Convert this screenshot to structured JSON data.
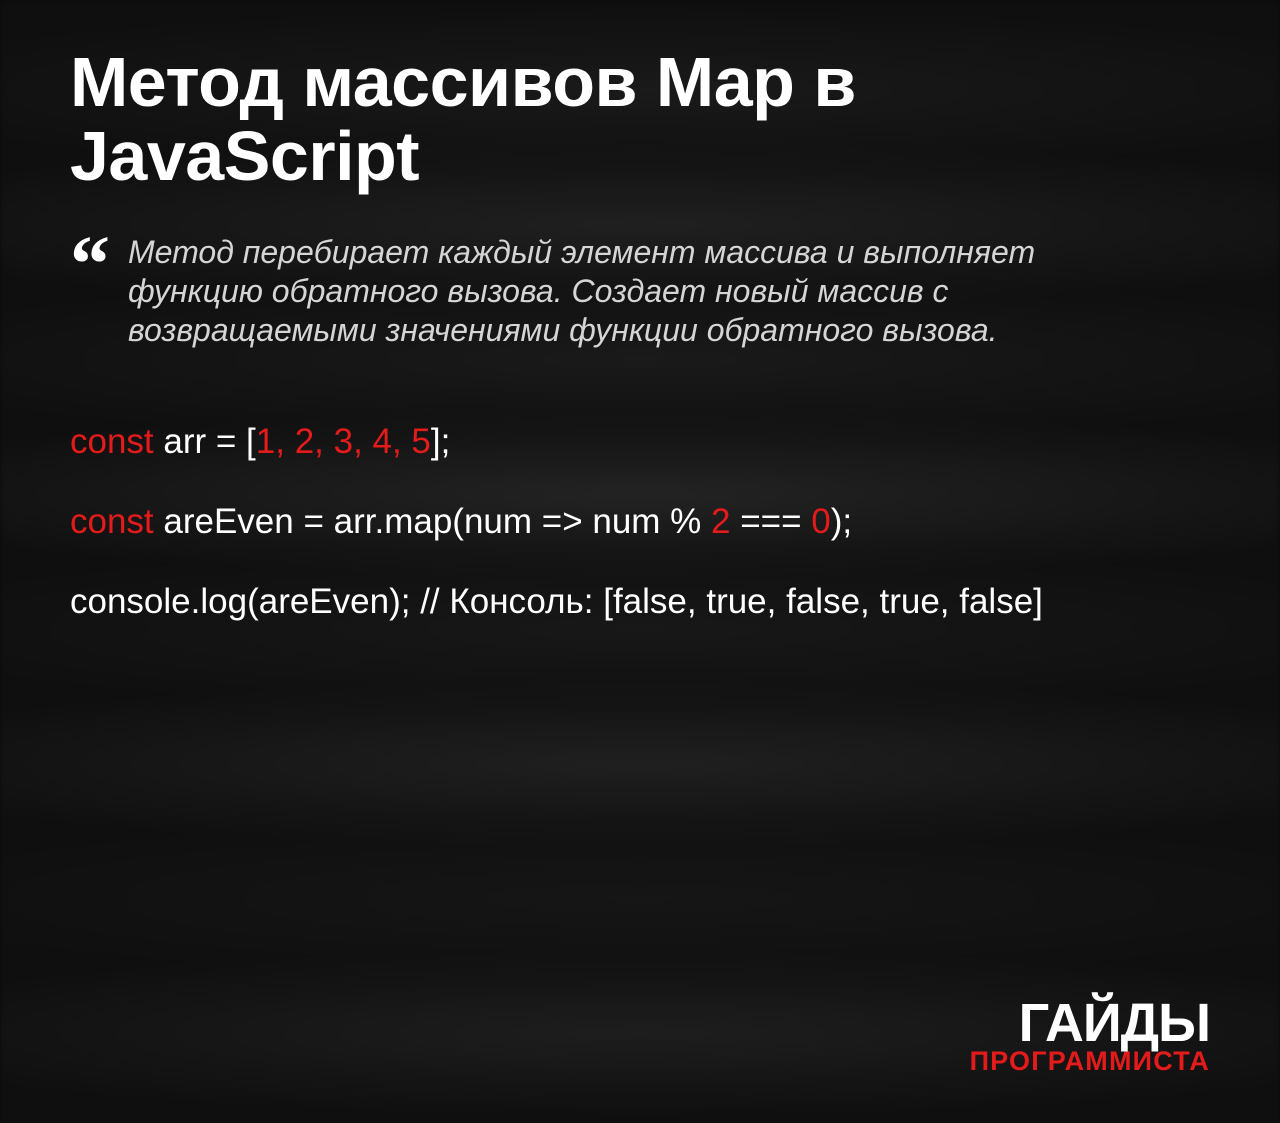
{
  "title": "Метод массивов Map в JavaScript",
  "description": "Метод перебирает каждый элемент массива и выполняет функцию обратного вызова. Создает новый массив с возвращаемыми значениями функции обратного вызова.",
  "code": {
    "line1": {
      "kw": "const",
      "part1": " arr = [",
      "nums": "1, 2, 3, 4, 5",
      "part2": "];"
    },
    "line2": {
      "kw": "const",
      "part1": " areEven = arr.map(num => num % ",
      "num1": "2",
      "part2": " === ",
      "num2": "0",
      "part3": ");"
    },
    "line3": "console.log(areEven); // Консоль: [false, true, false, true, false]"
  },
  "footer": {
    "top": "ГАЙДЫ",
    "bottom": "ПРОГРАММИСТА"
  },
  "colors": {
    "accent": "#e31b1b",
    "text": "#ffffff",
    "background": "#0f0f0f"
  }
}
